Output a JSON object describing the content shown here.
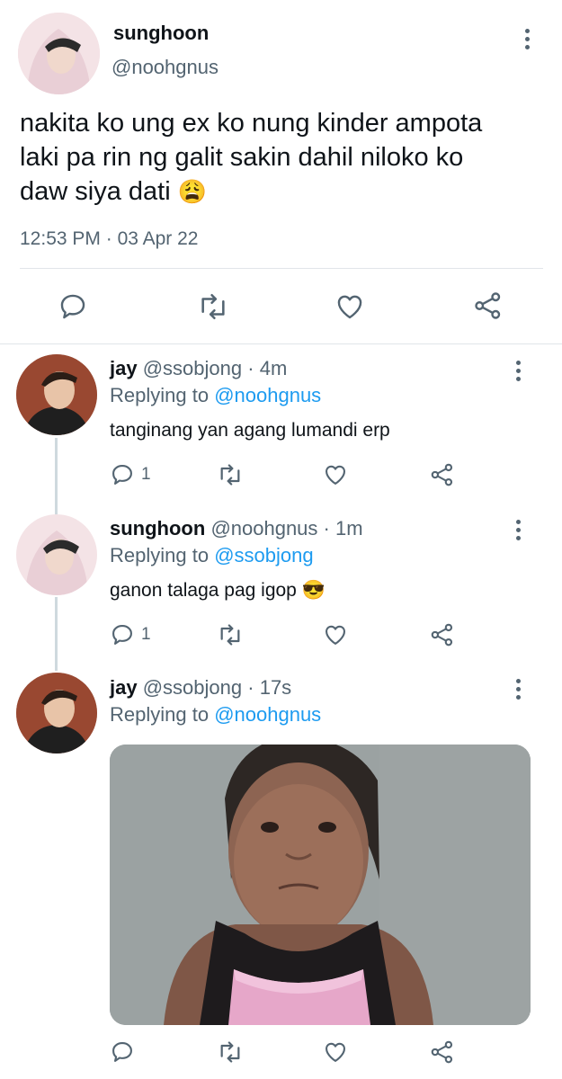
{
  "main_tweet": {
    "display_name": "sunghoon",
    "handle": "@noohgnus",
    "text_lines": [
      "nakita ko ung ex ko nung kinder ampota",
      "laki pa rin ng galit sakin dahil niloko ko",
      "daw siya dati"
    ],
    "emoji": "😩",
    "time": "12:53 PM",
    "date": "03 Apr 22",
    "time_sep": "·"
  },
  "replies": [
    {
      "display_name": "jay",
      "handle": "@ssobjong",
      "age": "4m",
      "replying_label": "Replying to",
      "replying_to": "@noohgnus",
      "text": "tanginang yan agang lumandi erp",
      "reply_count": "1"
    },
    {
      "display_name": "sunghoon",
      "handle": "@noohgnus",
      "age": "1m",
      "replying_label": "Replying to",
      "replying_to": "@ssobjong",
      "text": "ganon talaga pag igop",
      "emoji": "😎",
      "reply_count": "1"
    },
    {
      "display_name": "jay",
      "handle": "@ssobjong",
      "age": "17s",
      "replying_label": "Replying to",
      "replying_to": "@noohgnus",
      "media": "photo-of-child-in-pink-top"
    }
  ],
  "sep": "·",
  "icons": [
    "reply-icon",
    "retweet-icon",
    "like-icon",
    "share-icon",
    "more-icon"
  ],
  "colors": {
    "link": "#1d9bf0",
    "secondary": "#536471",
    "text": "#0f1419"
  }
}
